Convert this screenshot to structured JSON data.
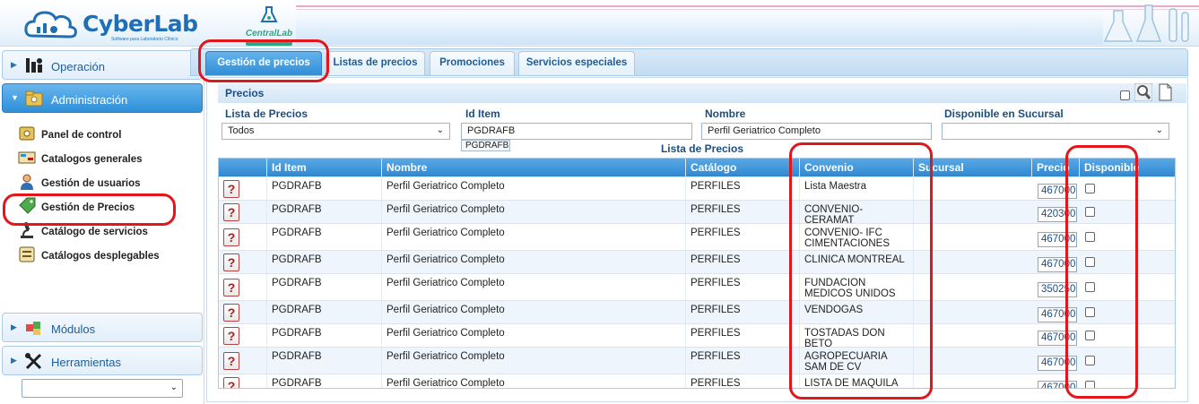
{
  "header": {
    "brand": "CyberLab",
    "brand_sub": "Software para Laboratorio Clínico",
    "lab_name": "CentralLab",
    "colors": {
      "brand": "#1e6fb5",
      "accent": "#2f8ed6",
      "lab": "#2aa78a"
    }
  },
  "sidebar": {
    "sections": [
      {
        "label": "Operación",
        "icon": "operation-people-icon"
      },
      {
        "label": "Administración",
        "icon": "folder-icon"
      },
      {
        "label": "Módulos",
        "icon": "puzzle-icon"
      },
      {
        "label": "Herramientas",
        "icon": "tools-icon"
      }
    ],
    "items": [
      {
        "label": "Panel de control",
        "icon": "control-panel-icon"
      },
      {
        "label": "Catalogos generales",
        "icon": "catalog-icon"
      },
      {
        "label": "Gestión de usuarios",
        "icon": "user-icon"
      },
      {
        "label": "Gestión de Precios",
        "icon": "price-tag-icon"
      },
      {
        "label": "Catálogo de servicios",
        "icon": "microscope-icon"
      },
      {
        "label": "Catálogos desplegables",
        "icon": "dropdown-list-icon"
      }
    ],
    "select_value": ""
  },
  "tabs": [
    {
      "label": "Gestión de precios"
    },
    {
      "label": "Listas de precios"
    },
    {
      "label": "Promociones"
    },
    {
      "label": "Servicios especiales"
    }
  ],
  "panel": {
    "title": "Precios",
    "filters": {
      "lista_label": "Lista de Precios",
      "lista_value": "Todos",
      "id_label": "Id Item",
      "id_value": "PGDRAFB",
      "id_suggestion": "PGDRAFB",
      "nombre_label": "Nombre",
      "nombre_value": "Perfil Geriatrico Completo",
      "disponible_label": "Disponible en Sucursal",
      "disponible_value": ""
    },
    "grid_title": "Lista de Precios",
    "columns": {
      "id": "Id Item",
      "nombre": "Nombre",
      "catalogo": "Catálogo",
      "convenio": "Convenio",
      "sucursal": "Sucursal",
      "precio": "Precio",
      "disponible": "Disponible"
    },
    "rows": [
      {
        "id": "PGDRAFB",
        "nombre": "Perfil Geriatrico Completo",
        "catalogo": "PERFILES",
        "convenio": "Lista Maestra",
        "sucursal": "",
        "precio": "467000"
      },
      {
        "id": "PGDRAFB",
        "nombre": "Perfil Geriatrico Completo",
        "catalogo": "PERFILES",
        "convenio": "CONVENIO-CERAMAT",
        "sucursal": "",
        "precio": "420300"
      },
      {
        "id": "PGDRAFB",
        "nombre": "Perfil Geriatrico Completo",
        "catalogo": "PERFILES",
        "convenio": "CONVENIO- IFC CIMENTACIONES",
        "sucursal": "",
        "precio": "467000"
      },
      {
        "id": "PGDRAFB",
        "nombre": "Perfil Geriatrico Completo",
        "catalogo": "PERFILES",
        "convenio": "CLINICA MONTREAL",
        "sucursal": "",
        "precio": "467000"
      },
      {
        "id": "PGDRAFB",
        "nombre": "Perfil Geriatrico Completo",
        "catalogo": "PERFILES",
        "convenio": "FUNDACION MEDICOS UNIDOS",
        "sucursal": "",
        "precio": "350250"
      },
      {
        "id": "PGDRAFB",
        "nombre": "Perfil Geriatrico Completo",
        "catalogo": "PERFILES",
        "convenio": "VENDOGAS",
        "sucursal": "",
        "precio": "467000"
      },
      {
        "id": "PGDRAFB",
        "nombre": "Perfil Geriatrico Completo",
        "catalogo": "PERFILES",
        "convenio": "TOSTADAS DON BETO",
        "sucursal": "",
        "precio": "467000"
      },
      {
        "id": "PGDRAFB",
        "nombre": "Perfil Geriatrico Completo",
        "catalogo": "PERFILES",
        "convenio": "AGROPECUARIA SAM DE CV",
        "sucursal": "",
        "precio": "467000"
      },
      {
        "id": "PGDRAFB",
        "nombre": "Perfil Geriatrico Completo",
        "catalogo": "PERFILES",
        "convenio": "LISTA DE MAQUILA",
        "sucursal": "",
        "precio": "467000"
      }
    ]
  }
}
